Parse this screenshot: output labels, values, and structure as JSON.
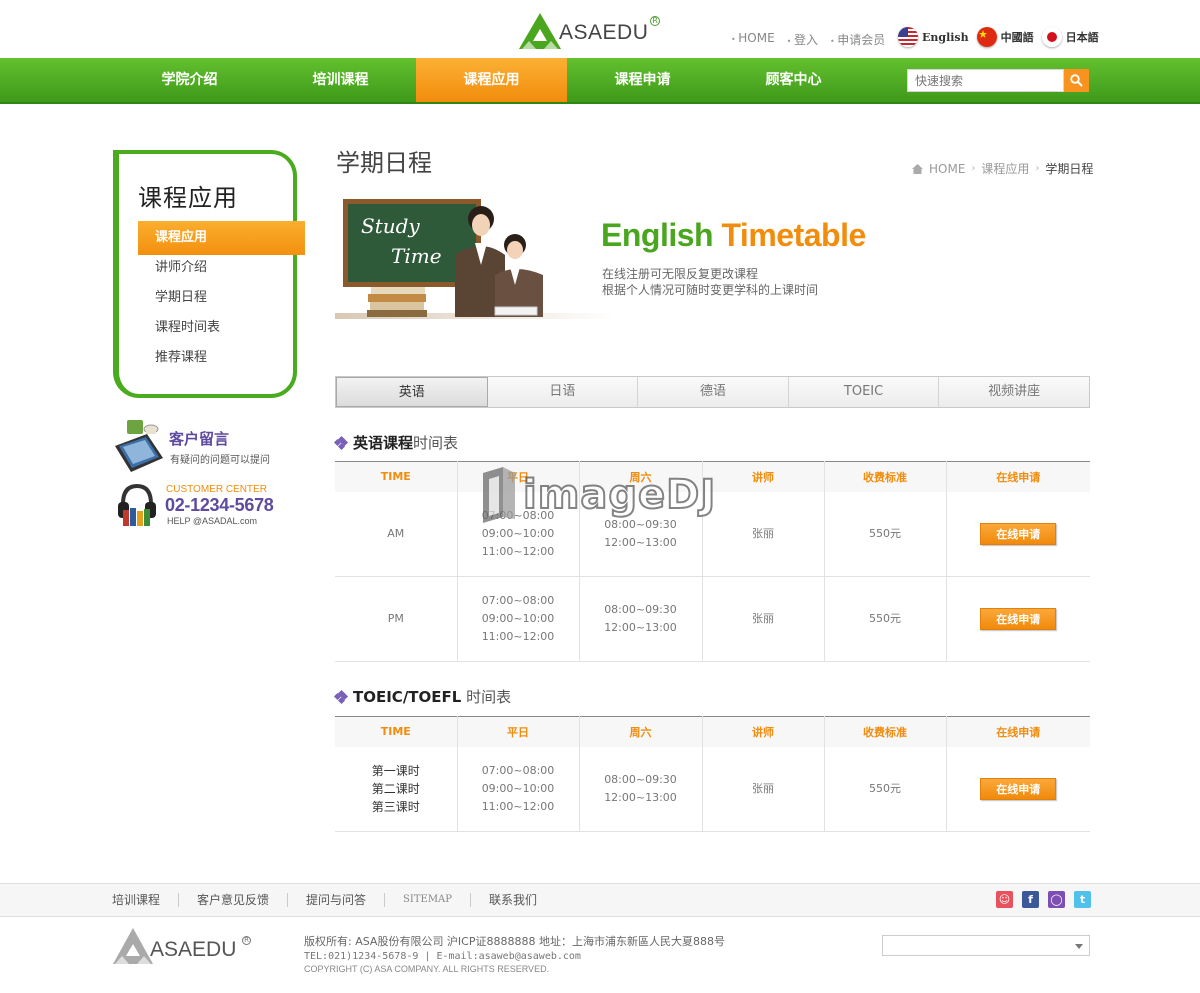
{
  "brand": {
    "name": "ASAEDU",
    "reg": "R"
  },
  "top_links": [
    "HOME",
    "登入",
    "申请会员"
  ],
  "languages": [
    {
      "label": "English",
      "icon": "us-flag-icon"
    },
    {
      "label": "中國語",
      "icon": "cn-flag-icon"
    },
    {
      "label": "日本語",
      "icon": "jp-flag-icon"
    }
  ],
  "gnb": [
    "学院介绍",
    "培训课程",
    "课程应用",
    "课程申请",
    "顾客中心"
  ],
  "gnb_active": 2,
  "search": {
    "placeholder": "快速搜索",
    "icon": "search-icon"
  },
  "lnb": {
    "title": "课程应用",
    "items": [
      "课程应用",
      "讲师介绍",
      "学期日程",
      "课程时间表",
      "推荐课程"
    ],
    "active": 0
  },
  "qna": {
    "title": "客户留言",
    "desc": "有疑问的问题可以提问"
  },
  "customer_center": {
    "label": "CUSTOMER CENTER",
    "phone": "02-1234-5678",
    "email": "HELP @ASADAL.com"
  },
  "page_title": "学期日程",
  "breadcrumb": [
    "HOME",
    "课程应用",
    "学期日程"
  ],
  "banner": {
    "board_text_1": "Study",
    "board_text_2": "Time",
    "title_green": "English",
    "title_orange": "Timetable",
    "line1": "在线注册可无限反复更改课程",
    "line2": "根据个人情况可随时变更学科的上课时间"
  },
  "tabs": [
    "英语",
    "日语",
    "德语",
    "TOEIC",
    "视频讲座"
  ],
  "tab_active": 0,
  "section1": {
    "title_bold": "英语课程",
    "title_normal": "时间表",
    "headers": [
      "TIME",
      "平日",
      "周六",
      "讲师",
      "收费标准",
      "在线申请"
    ],
    "rows": [
      {
        "time": "AM",
        "weekday": [
          "07:00~08:00",
          "09:00~10:00",
          "11:00~12:00"
        ],
        "saturday": [
          "08:00~09:30",
          "12:00~13:00"
        ],
        "teacher": "张丽",
        "fee": "550元",
        "button": "在线申请"
      },
      {
        "time": "PM",
        "weekday": [
          "07:00~08:00",
          "09:00~10:00",
          "11:00~12:00"
        ],
        "saturday": [
          "08:00~09:30",
          "12:00~13:00"
        ],
        "teacher": "张丽",
        "fee": "550元",
        "button": "在线申请"
      }
    ]
  },
  "section2": {
    "title_bold": "TOEIC/TOEFL",
    "title_normal": "时间表",
    "headers": [
      "TIME",
      "平日",
      "周六",
      "讲师",
      "收费标准",
      "在线申请"
    ],
    "rows": [
      {
        "time": [
          "第一课时",
          "第二课时",
          "第三课时"
        ],
        "weekday": [
          "07:00~08:00",
          "09:00~10:00",
          "11:00~12:00"
        ],
        "saturday": [
          "08:00~09:30",
          "12:00~13:00"
        ],
        "teacher": "张丽",
        "fee": "550元",
        "button": "在线申请"
      }
    ]
  },
  "watermark": "imageDJ",
  "footer": {
    "links": [
      "培训课程",
      "客户意见反馈",
      "提问与问答",
      "SITEMAP",
      "联系我们"
    ],
    "socials": [
      {
        "icon": "kakao-icon",
        "color": "#e8515e"
      },
      {
        "icon": "facebook-icon",
        "color": "#3b5998"
      },
      {
        "icon": "chat-bubble-icon",
        "color": "#7d4fb3"
      },
      {
        "icon": "twitter-icon",
        "color": "#4fc1ea"
      }
    ],
    "line1": "版权所有: ASA股份有限公司 沪ICP证8888888 地址：上海市浦东新區人民大夏888号",
    "line2": "TEL:021)1234-5678-9 | E-mail:asaweb@asaweb.com",
    "line3": "COPYRIGHT (C) ASA COMPANY. ALL RIGHTS RESERVED.",
    "family_site_value": ""
  },
  "colors": {
    "green": "#4aa51f",
    "orange": "#f28c0d",
    "purple": "#5f4b9e"
  }
}
